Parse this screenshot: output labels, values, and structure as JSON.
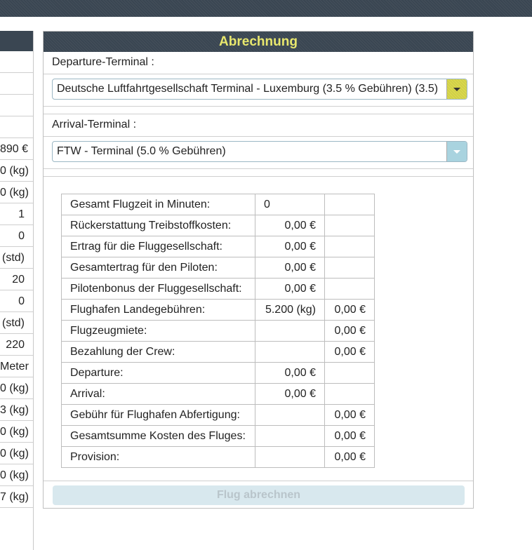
{
  "left_panel": {
    "values": [
      "890 €",
      "0 (kg)",
      "0 (kg)",
      "1",
      "0",
      "(std)",
      "20",
      "0",
      "(std)",
      "220",
      "Meter",
      "0 (kg)",
      "3 (kg)",
      "0 (kg)",
      "0 (kg)",
      "0 (kg)",
      "7 (kg)"
    ]
  },
  "panel": {
    "title": "Abrechnung",
    "departure_label": "Departure-Terminal :",
    "departure_value": "Deutsche Luftfahrtgesellschaft Terminal - Luxemburg (3.5 % Gebühren) (3.5)",
    "arrival_label": "Arrival-Terminal :",
    "arrival_value": "FTW - Terminal (5.0 % Gebühren)",
    "submit_label": "Flug abrechnen"
  },
  "table": {
    "rows": [
      {
        "label": "Gesamt Flugzeit in Minuten:",
        "value": "0",
        "cost": ""
      },
      {
        "label": "Rückerstattung Treibstoffkosten:",
        "value": "0,00 €",
        "cost": ""
      },
      {
        "label": "Ertrag für die Fluggesellschaft:",
        "value": "0,00 €",
        "cost": ""
      },
      {
        "label": "Gesamtertrag für den Piloten:",
        "value": "0,00 €",
        "cost": ""
      },
      {
        "label": "Pilotenbonus der Fluggesellschaft:",
        "value": "0,00 €",
        "cost": ""
      },
      {
        "label": "Flughafen Landegebühren:",
        "value": "5.200 (kg)",
        "cost": "0,00 €"
      },
      {
        "label": "Flugzeugmiete:",
        "value": "",
        "cost": "0,00 €"
      },
      {
        "label": "Bezahlung der Crew:",
        "value": "",
        "cost": "0,00 €"
      },
      {
        "label": "Departure:",
        "value": "0,00 €",
        "cost": ""
      },
      {
        "label": "Arrival:",
        "value": "0,00 €",
        "cost": ""
      },
      {
        "label": "Gebühr für Flughafen Abfertigung:",
        "value": "",
        "cost": "0,00 €"
      },
      {
        "label": "Gesamtsumme Kosten des Fluges:",
        "value": "",
        "cost": "0,00 €"
      },
      {
        "label": "Provision:",
        "value": "",
        "cost": "0,00 €"
      }
    ]
  }
}
